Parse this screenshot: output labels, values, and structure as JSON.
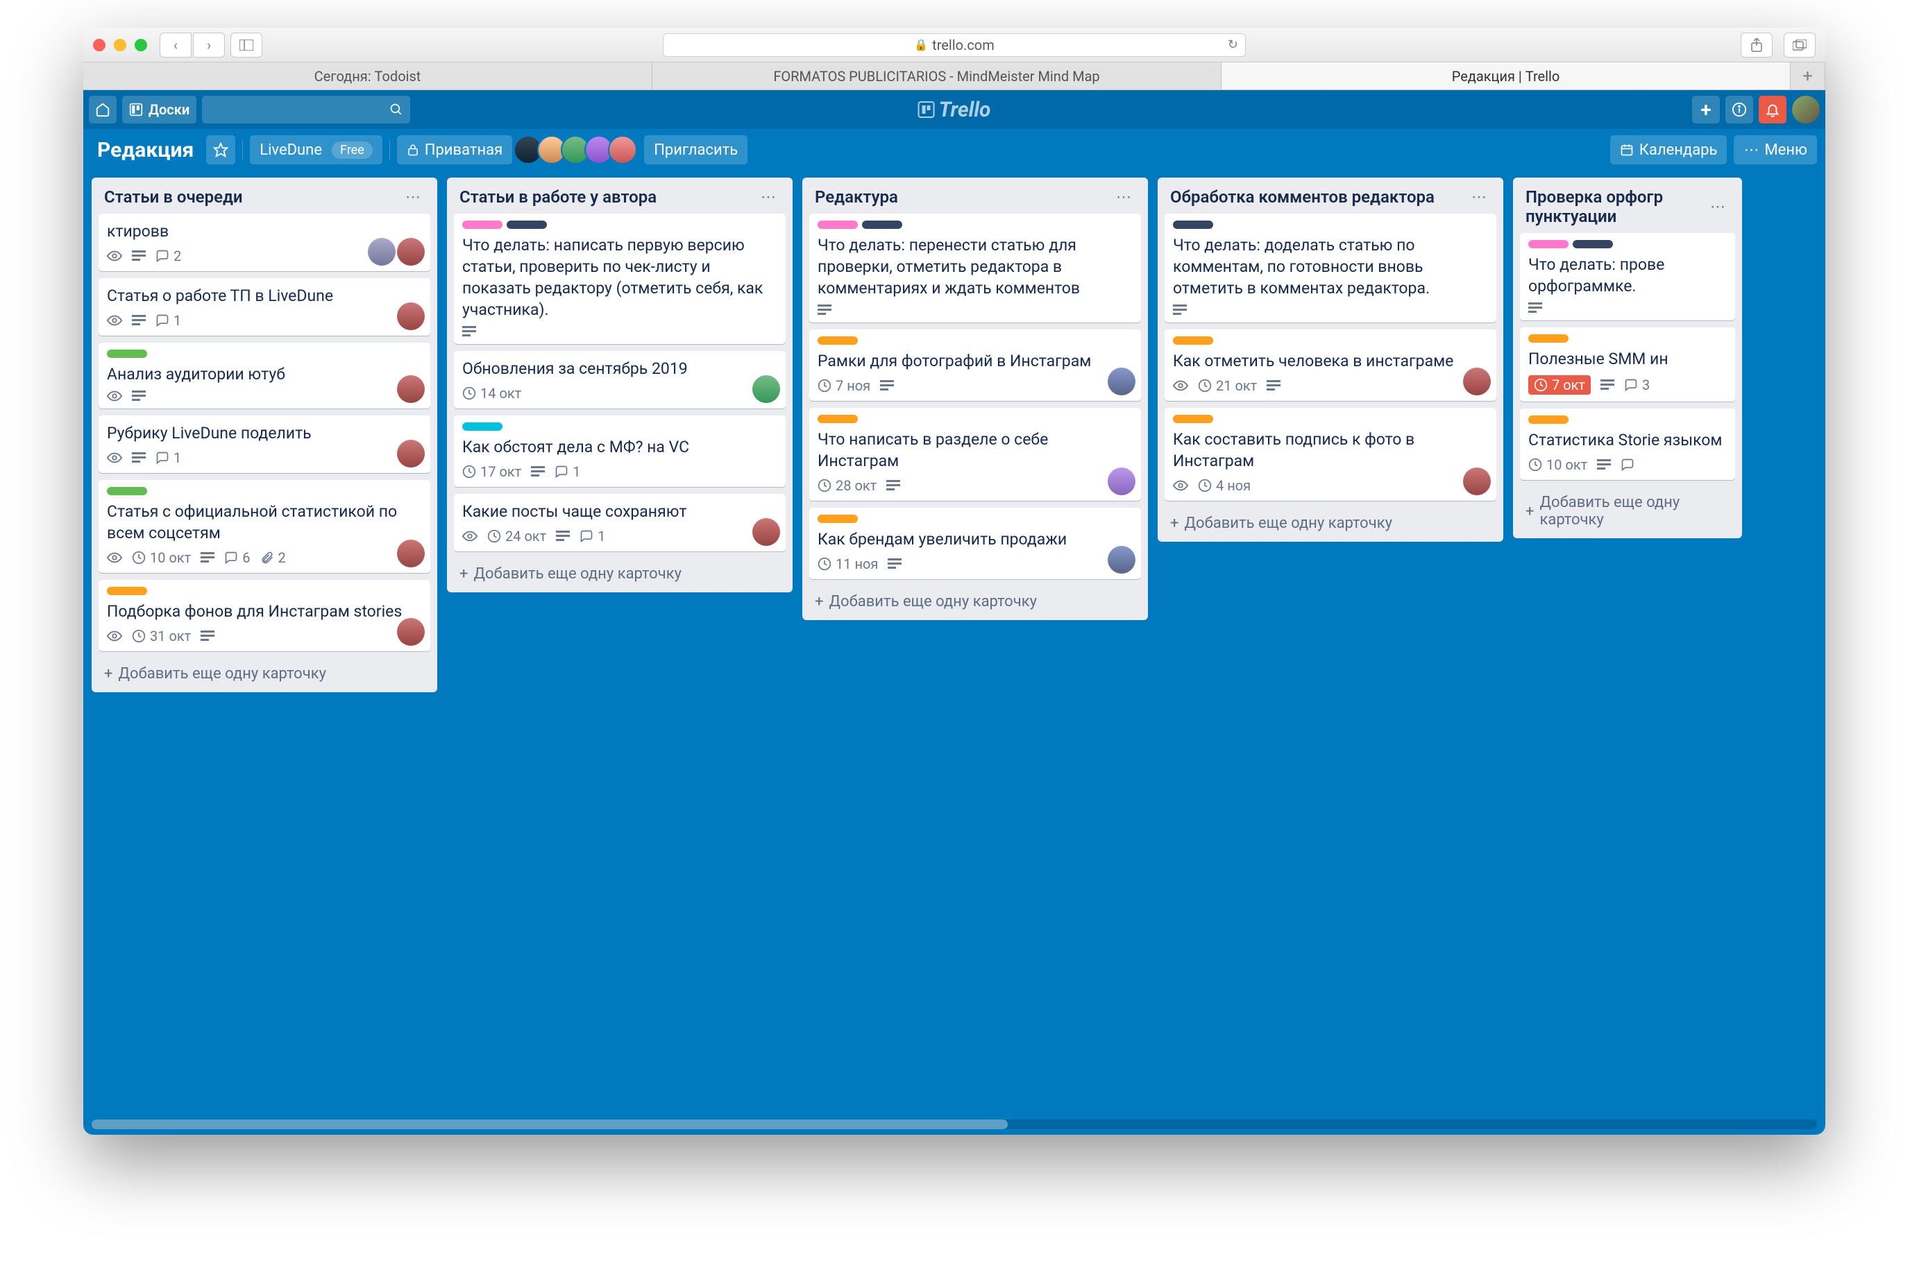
{
  "browser": {
    "url_host": "trello.com",
    "tabs": [
      "Сегодня: Todoist",
      "FORMATOS PUBLICITARIOS - MindMeister Mind Map",
      "Редакция | Trello"
    ],
    "active_tab": 2
  },
  "global_header": {
    "boards_label": "Доски",
    "logo": "Trello"
  },
  "board_header": {
    "board_name": "Редакция",
    "team_name": "LiveDune",
    "team_plan": "Free",
    "visibility": "Приватная",
    "invite_label": "Пригласить",
    "calendar_label": "Календарь",
    "menu_label": "Меню"
  },
  "lists": [
    {
      "name": "Статьи в очереди",
      "cards": [
        {
          "title": "ктировв",
          "labels": [],
          "badges": {
            "watch": true,
            "desc": true,
            "comments": 2
          },
          "members": 2
        },
        {
          "title": "Статья о работе ТП в LiveDune",
          "labels": [],
          "badges": {
            "watch": true,
            "desc": true,
            "comments": 1
          },
          "members": 1
        },
        {
          "title": "Анализ аудитории ютуб",
          "labels": [
            "green"
          ],
          "badges": {
            "watch": true,
            "desc": true
          },
          "members": 1
        },
        {
          "title": "Рубрику LiveDune поделить",
          "labels": [],
          "badges": {
            "watch": true,
            "desc": true,
            "comments": 1
          },
          "members": 1
        },
        {
          "title": "Статья с официальной статистикой по всем соцсетям",
          "labels": [
            "green"
          ],
          "badges": {
            "watch": true,
            "due": "10 окт",
            "desc": true,
            "comments": 6,
            "attach": 2
          },
          "members": 1
        },
        {
          "title": "Подборка фонов для Инстаграм stories",
          "labels": [
            "orange"
          ],
          "badges": {
            "watch": true,
            "due": "31 окт",
            "desc": true
          },
          "members": 1
        }
      ]
    },
    {
      "name": "Статьи в работе у автора",
      "cards": [
        {
          "title": "Что делать: написать первую версию статьи, проверить по чек-листу и показать редактору (отметить себя, как участника).",
          "labels": [
            "pink",
            "navy"
          ],
          "badges": {
            "desc": true
          },
          "members": 0
        },
        {
          "title": "Обновления за сентябрь 2019",
          "labels": [],
          "badges": {
            "due": "14 окт"
          },
          "members": 1,
          "avatar": "g"
        },
        {
          "title": "Как обстоят дела с МФ? на VC",
          "labels": [
            "sky"
          ],
          "badges": {
            "due": "17 окт",
            "desc": true,
            "comments": 1
          },
          "members": 0
        },
        {
          "title": "Какие посты чаще сохраняют",
          "labels": [],
          "badges": {
            "watch": true,
            "due": "24 окт",
            "desc": true,
            "comments": 1
          },
          "members": 1
        }
      ]
    },
    {
      "name": "Редактура",
      "cards": [
        {
          "title": "Что делать: перенести статью для проверки, отметить редактора в комментариях и ждать комментов",
          "labels": [
            "pink",
            "navy"
          ],
          "badges": {
            "desc": true
          },
          "members": 0
        },
        {
          "title": "Рамки для фотографий в Инстаграм",
          "labels": [
            "orange"
          ],
          "badges": {
            "due": "7 ноя",
            "desc": true
          },
          "members": 1,
          "avatar": "b"
        },
        {
          "title": "Что написать в разделе о себе Инстаграм",
          "labels": [
            "orange"
          ],
          "badges": {
            "due": "28 окт",
            "desc": true
          },
          "members": 1,
          "avatar": "p"
        },
        {
          "title": "Как брендам увеличить продажи",
          "labels": [
            "orange"
          ],
          "badges": {
            "due": "11 ноя",
            "desc": true
          },
          "members": 1,
          "avatar": "b"
        }
      ]
    },
    {
      "name": "Обработка комментов редактора",
      "cards": [
        {
          "title": "Что делать: доделать статью по комментам, по готовности вновь отметить в комментах редактора.",
          "labels": [
            "navy"
          ],
          "badges": {
            "desc": true
          },
          "members": 0
        },
        {
          "title": "Как отметить человека в инстаграме",
          "labels": [
            "orange"
          ],
          "badges": {
            "watch": true,
            "due": "21 окт",
            "desc": true
          },
          "members": 1
        },
        {
          "title": "Как составить подпись к фото в Инстаграм",
          "labels": [
            "orange"
          ],
          "badges": {
            "watch": true,
            "due": "4 ноя"
          },
          "members": 1
        }
      ]
    },
    {
      "name": "Проверка орфогр пунктуации",
      "cards": [
        {
          "title": "Что делать: прове орфограммке.",
          "labels": [
            "pink",
            "navy"
          ],
          "badges": {
            "desc": true
          },
          "members": 0
        },
        {
          "title": "Полезные SMM ин",
          "labels": [
            "orange"
          ],
          "badges": {
            "due": "7 окт",
            "due_red": true,
            "desc": true,
            "comments": 3
          },
          "members": 0
        },
        {
          "title": "Статистика Storie языком",
          "labels": [
            "orange"
          ],
          "badges": {
            "due": "10 окт",
            "desc": true,
            "comments": ""
          },
          "members": 0
        }
      ]
    }
  ],
  "add_card_label": "Добавить еще одну карточку"
}
